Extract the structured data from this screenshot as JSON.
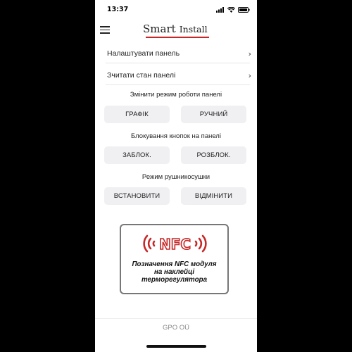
{
  "status_bar": {
    "time": "13:37"
  },
  "header": {
    "logo_word1": "Smart",
    "logo_word2": "Install"
  },
  "nav": [
    {
      "label": "Налаштувати панель"
    },
    {
      "label": "Зчитати стан панелі"
    }
  ],
  "mode": {
    "title": "Змінити режим роботи панелі",
    "left": "ГРАФІК",
    "right": "РУЧНИЙ"
  },
  "lock": {
    "title": "Блокування кнопок на панелі",
    "left": "ЗАБЛОК.",
    "right": "РОЗБЛОК."
  },
  "towel": {
    "title": "Режим рушникосушки",
    "left": "ВСТАНОВИТИ",
    "right": "ВІДМІНИТИ"
  },
  "nfc": {
    "logo_text": "NFC",
    "caption_lines": [
      "Позначення NFC модуля",
      "на  наклейці",
      "терморегулятора"
    ]
  },
  "footer": {
    "text": "GPO OÜ"
  },
  "colors": {
    "accent_red": "#c62828",
    "button_bg": "#f0f0f3"
  }
}
